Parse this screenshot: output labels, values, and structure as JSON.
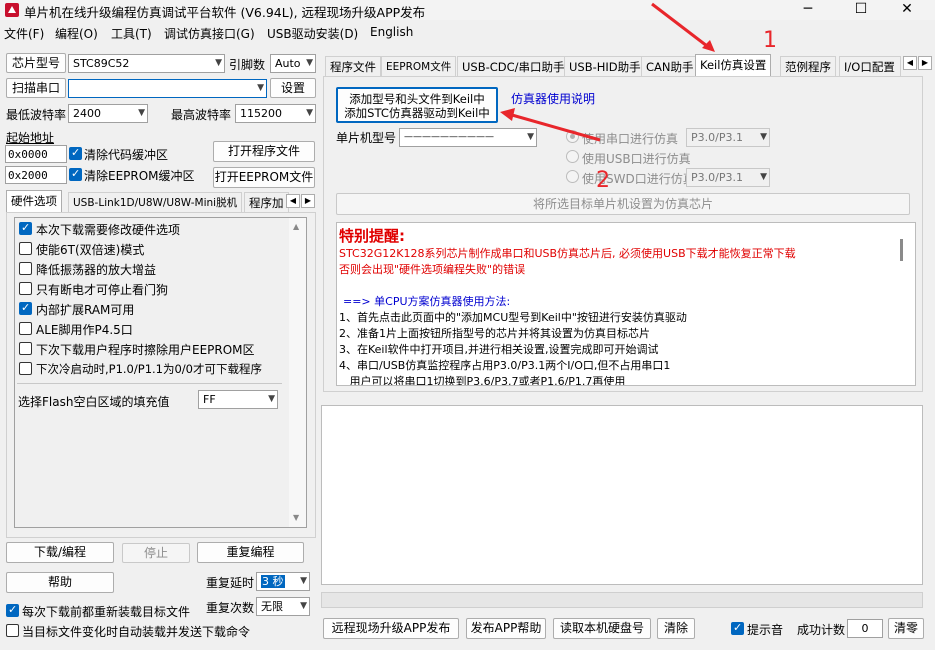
{
  "window": {
    "title": "单片机在线升级编程仿真调试平台软件 (V6.94L), 远程现场升级APP发布",
    "minimize": "─",
    "maximize": "☐",
    "close": "✕"
  },
  "menu": [
    "文件(F)",
    "编程(O)",
    "工具(T)",
    "调试仿真接口(G)",
    "USB驱动安装(D)",
    "English"
  ],
  "left": {
    "chip_btn": "芯片型号",
    "chip_value": "STC89C52",
    "pins_label": "引脚数",
    "pins_value": "Auto",
    "scan_btn": "扫描串口",
    "port_value": "",
    "settings_btn": "设置",
    "min_baud_label": "最低波特率",
    "min_baud_value": "2400",
    "max_baud_label": "最高波特率",
    "max_baud_value": "115200",
    "start_addr_label": "起始地址",
    "addr1": "0x0000",
    "clear_code": "清除代码缓冲区",
    "open_program": "打开程序文件",
    "addr2": "0x2000",
    "clear_eeprom": "清除EEPROM缓冲区",
    "open_eeprom": "打开EEPROM文件",
    "tabs": [
      "硬件选项",
      "USB-Link1D/U8W/U8W-Mini脱机",
      "程序加"
    ],
    "options": [
      {
        "label": "本次下载需要修改硬件选项",
        "checked": true
      },
      {
        "label": "使能6T(双倍速)模式",
        "checked": false
      },
      {
        "label": "降低振荡器的放大增益",
        "checked": false
      },
      {
        "label": "只有断电才可停止看门狗",
        "checked": false
      },
      {
        "label": "内部扩展RAM可用",
        "checked": true
      },
      {
        "label": "ALE脚用作P4.5口",
        "checked": false
      },
      {
        "label": "下次下载用户程序时擦除用户EEPROM区",
        "checked": false
      },
      {
        "label": "下次冷启动时,P1.0/P1.1为0/0才可下载程序",
        "checked": false
      }
    ],
    "flash_fill_label": "选择Flash空白区域的填充值",
    "flash_fill_value": "FF",
    "download_btn": "下载/编程",
    "stop_btn": "停止",
    "reprogram_btn": "重复编程",
    "help_btn": "帮助",
    "repeat_delay_label": "重复延时",
    "repeat_delay_value": "3 秒",
    "repeat_count_label": "重复次数",
    "repeat_count_value": "无限",
    "reload_each": "每次下载前都重新装载目标文件",
    "auto_load": "当目标文件变化时自动装载并发送下载命令"
  },
  "right": {
    "tabs": [
      "程序文件",
      "EEPROM文件",
      "USB-CDC/串口助手",
      "USB-HID助手",
      "CAN助手",
      "Keil仿真设置",
      "范例程序",
      "I/O口配置"
    ],
    "active_tab_index": 5,
    "add_keil_btn_line1": "添加型号和头文件到Keil中",
    "add_keil_btn_line2": "添加STC仿真器驱动到Keil中",
    "emu_help_link": "仿真器使用说明",
    "mcu_label": "单片机型号",
    "mcu_value": "——————————",
    "radio_serial": "使用串口进行仿真",
    "radio_serial_port": "P3.0/P3.1",
    "radio_usb": "使用USB口进行仿真",
    "radio_swd": "使用SWD口进行仿真",
    "radio_swd_port": "P3.0/P3.1",
    "set_emu_btn": "将所选目标单片机设置为仿真芯片",
    "notice_title": "特别提醒:",
    "notice_line1": "STC32G12K128系列芯片制作成串口和USB仿真芯片后, 必须使用USB下载才能恢复正常下载",
    "notice_line2": "否则会出现\"硬件选项编程失败\"的错误",
    "method_title": "==> 单CPU方案仿真器使用方法:",
    "steps": [
      "1、首先点击此页面中的\"添加MCU型号到Keil中\"按钮进行安装仿真驱动",
      "2、准备1片上面按钮所指型号的芯片并将其设置为仿真目标芯片",
      "3、在Keil软件中打开项目,并进行相关设置,设置完成即可开始调试",
      "4、串口/USB仿真监控程序占用P3.0/P3.1两个I/O口,但不占用串口1",
      "   用户可以将串口1切换到P3.6/P3.7或者P1.6/P1.7再使用"
    ],
    "annotation1": "1",
    "annotation2": "2",
    "publish_btn": "远程现场升级APP发布",
    "publish_help_btn": "发布APP帮助",
    "read_disk_btn": "读取本机硬盘号",
    "clear_btn": "清除",
    "beep_label": "提示音",
    "success_label": "成功计数",
    "success_value": "0",
    "reset_btn": "清零"
  }
}
